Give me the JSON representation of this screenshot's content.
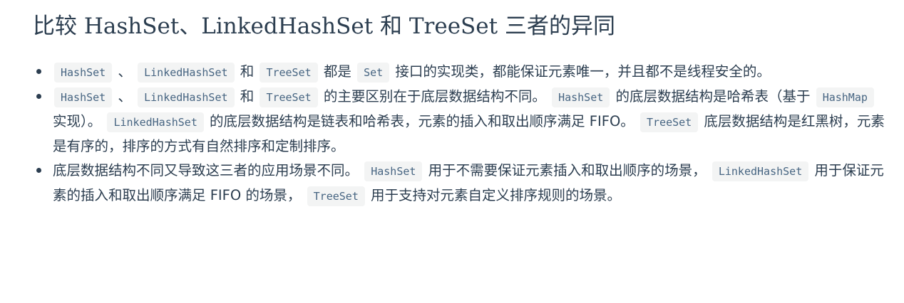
{
  "title": "比较 HashSet、LinkedHashSet 和 TreeSet 三者的异同",
  "points": [
    {
      "segments": [
        {
          "code": "HashSet"
        },
        {
          "text": " 、 "
        },
        {
          "code": "LinkedHashSet"
        },
        {
          "text": " 和 "
        },
        {
          "code": "TreeSet"
        },
        {
          "text": " 都是 "
        },
        {
          "code": "Set"
        },
        {
          "text": " 接口的实现类，都能保证元素唯一，并且都不是线程安全的。"
        }
      ]
    },
    {
      "segments": [
        {
          "code": "HashSet"
        },
        {
          "text": " 、 "
        },
        {
          "code": "LinkedHashSet"
        },
        {
          "text": " 和 "
        },
        {
          "code": "TreeSet"
        },
        {
          "text": " 的主要区别在于底层数据结构不同。 "
        },
        {
          "code": "HashSet"
        },
        {
          "text": " 的底层数据结构是哈希表（基于 "
        },
        {
          "code": "HashMap"
        },
        {
          "text": " 实现）。 "
        },
        {
          "code": "LinkedHashSet"
        },
        {
          "text": " 的底层数据结构是链表和哈希表，元素的插入和取出顺序满足 FIFO。 "
        },
        {
          "code": "TreeSet"
        },
        {
          "text": " 底层数据结构是红黑树，元素是有序的，排序的方式有自然排序和定制排序。"
        }
      ]
    },
    {
      "segments": [
        {
          "text": "底层数据结构不同又导致这三者的应用场景不同。 "
        },
        {
          "code": "HashSet"
        },
        {
          "text": " 用于不需要保证元素插入和取出顺序的场景， "
        },
        {
          "code": "LinkedHashSet"
        },
        {
          "text": " 用于保证元素的插入和取出顺序满足 FIFO 的场景， "
        },
        {
          "code": "TreeSet"
        },
        {
          "text": " 用于支持对元素自定义排序规则的场景。"
        }
      ]
    }
  ]
}
